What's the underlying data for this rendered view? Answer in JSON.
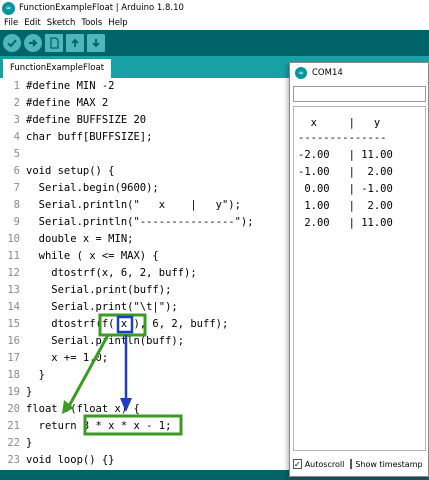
{
  "window": {
    "title": "FunctionExampleFloat | Arduino 1.8.10",
    "logo_icon": "arduino-logo-icon"
  },
  "menu": [
    "File",
    "Edit",
    "Sketch",
    "Tools",
    "Help"
  ],
  "toolbar": {
    "buttons": [
      "verify-icon",
      "upload-icon",
      "new-icon",
      "open-icon",
      "save-icon"
    ],
    "colors": {
      "bar": "#006468",
      "button": "#4db7bb"
    }
  },
  "tab": {
    "label": "FunctionExampleFloat"
  },
  "editor": {
    "line_numbers": [
      "1",
      "2",
      "3",
      "4",
      "5",
      "6",
      "7",
      "8",
      "9",
      "10",
      "11",
      "12",
      "13",
      "14",
      "15",
      "16",
      "17",
      "18",
      "19",
      "20",
      "21",
      "22",
      "23"
    ],
    "lines": [
      "#define MIN -2",
      "#define MAX 2",
      "#define BUFFSIZE 20",
      "char buff[BUFFSIZE];",
      "",
      "void setup() {",
      "  Serial.begin(9600);",
      "  Serial.println(\"   x    |   y\");",
      "  Serial.println(\"---------------\");",
      "  double x = MIN;",
      "  while ( x <= MAX) {",
      "    dtostrf(x, 6, 2, buff);",
      "    Serial.print(buff);",
      "    Serial.print(\"\\t|\");",
      "    dtostrf(f( x ), 6, 2, buff);",
      "    Serial.println(buff);",
      "    x += 1.0;",
      "  }",
      "}",
      "float f(float x) {",
      "  return 3 * x * x - 1;",
      "}",
      "void loop() {}"
    ]
  },
  "annotation_colors": {
    "green": "#3a9a23",
    "blue": "#1f3ec8"
  },
  "serial_monitor": {
    "title": "COM14",
    "output": [
      "  x     |   y",
      "--------------",
      "-2.00   | 11.00",
      "-1.00   |  2.00",
      " 0.00   | -1.00",
      " 1.00   |  2.00",
      " 2.00   | 11.00"
    ],
    "autoscroll_label": "Autoscroll",
    "autoscroll_checked": true,
    "timestamp_label": "Show timestamp",
    "timestamp_checked": false
  }
}
